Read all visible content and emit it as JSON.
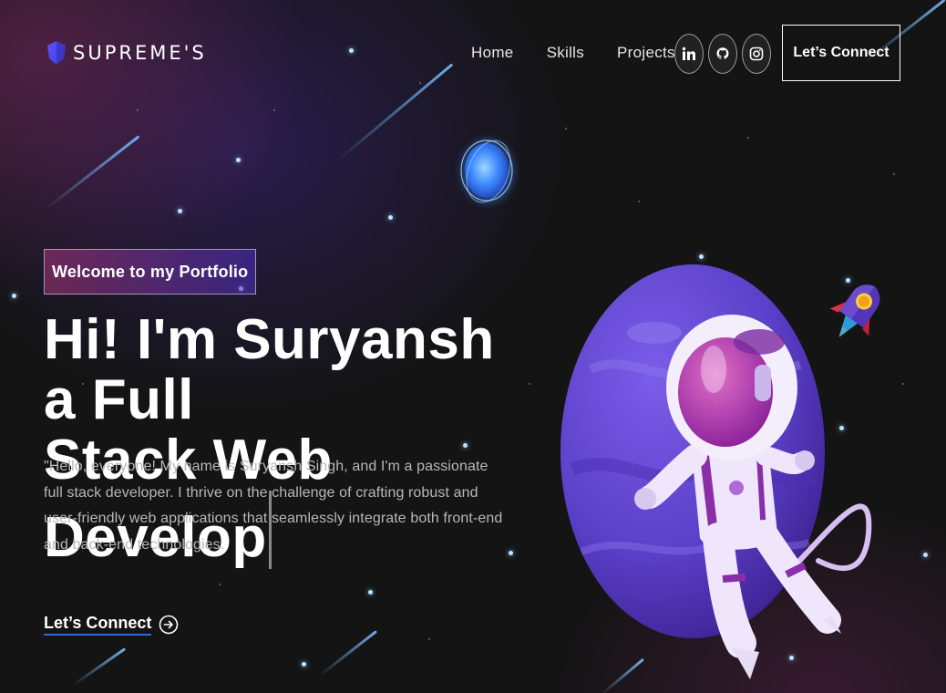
{
  "brand": {
    "name": "SUPREME'S",
    "icon": "shield-logo-icon"
  },
  "nav": {
    "links": [
      {
        "label": "Home"
      },
      {
        "label": "Skills"
      },
      {
        "label": "Projects"
      }
    ],
    "social": [
      {
        "name": "linkedin-icon"
      },
      {
        "name": "github-icon"
      },
      {
        "name": "instagram-icon"
      }
    ],
    "connect_label": "Let’s Connect"
  },
  "hero": {
    "tagline": "Welcome to my Portfolio",
    "headline_line1": "Hi! I'm Suryansh a Full",
    "headline_line2": "Stack Web Develop",
    "intro": "\"Hello, everyone! My name is Suryansh Singh, and I'm a passionate full stack developer. I thrive on the challenge of crafting robust and user-friendly web applications that seamlessly integrate both front-end and back-end technologies.",
    "cta_label": "Let’s Connect",
    "cta_icon": "arrow-right-circle-icon"
  },
  "colors": {
    "background": "#141414",
    "accent_blue": "#2f6bd8",
    "tagline_gradient_start": "#aa367c",
    "tagline_gradient_end": "#4a2fbd"
  }
}
